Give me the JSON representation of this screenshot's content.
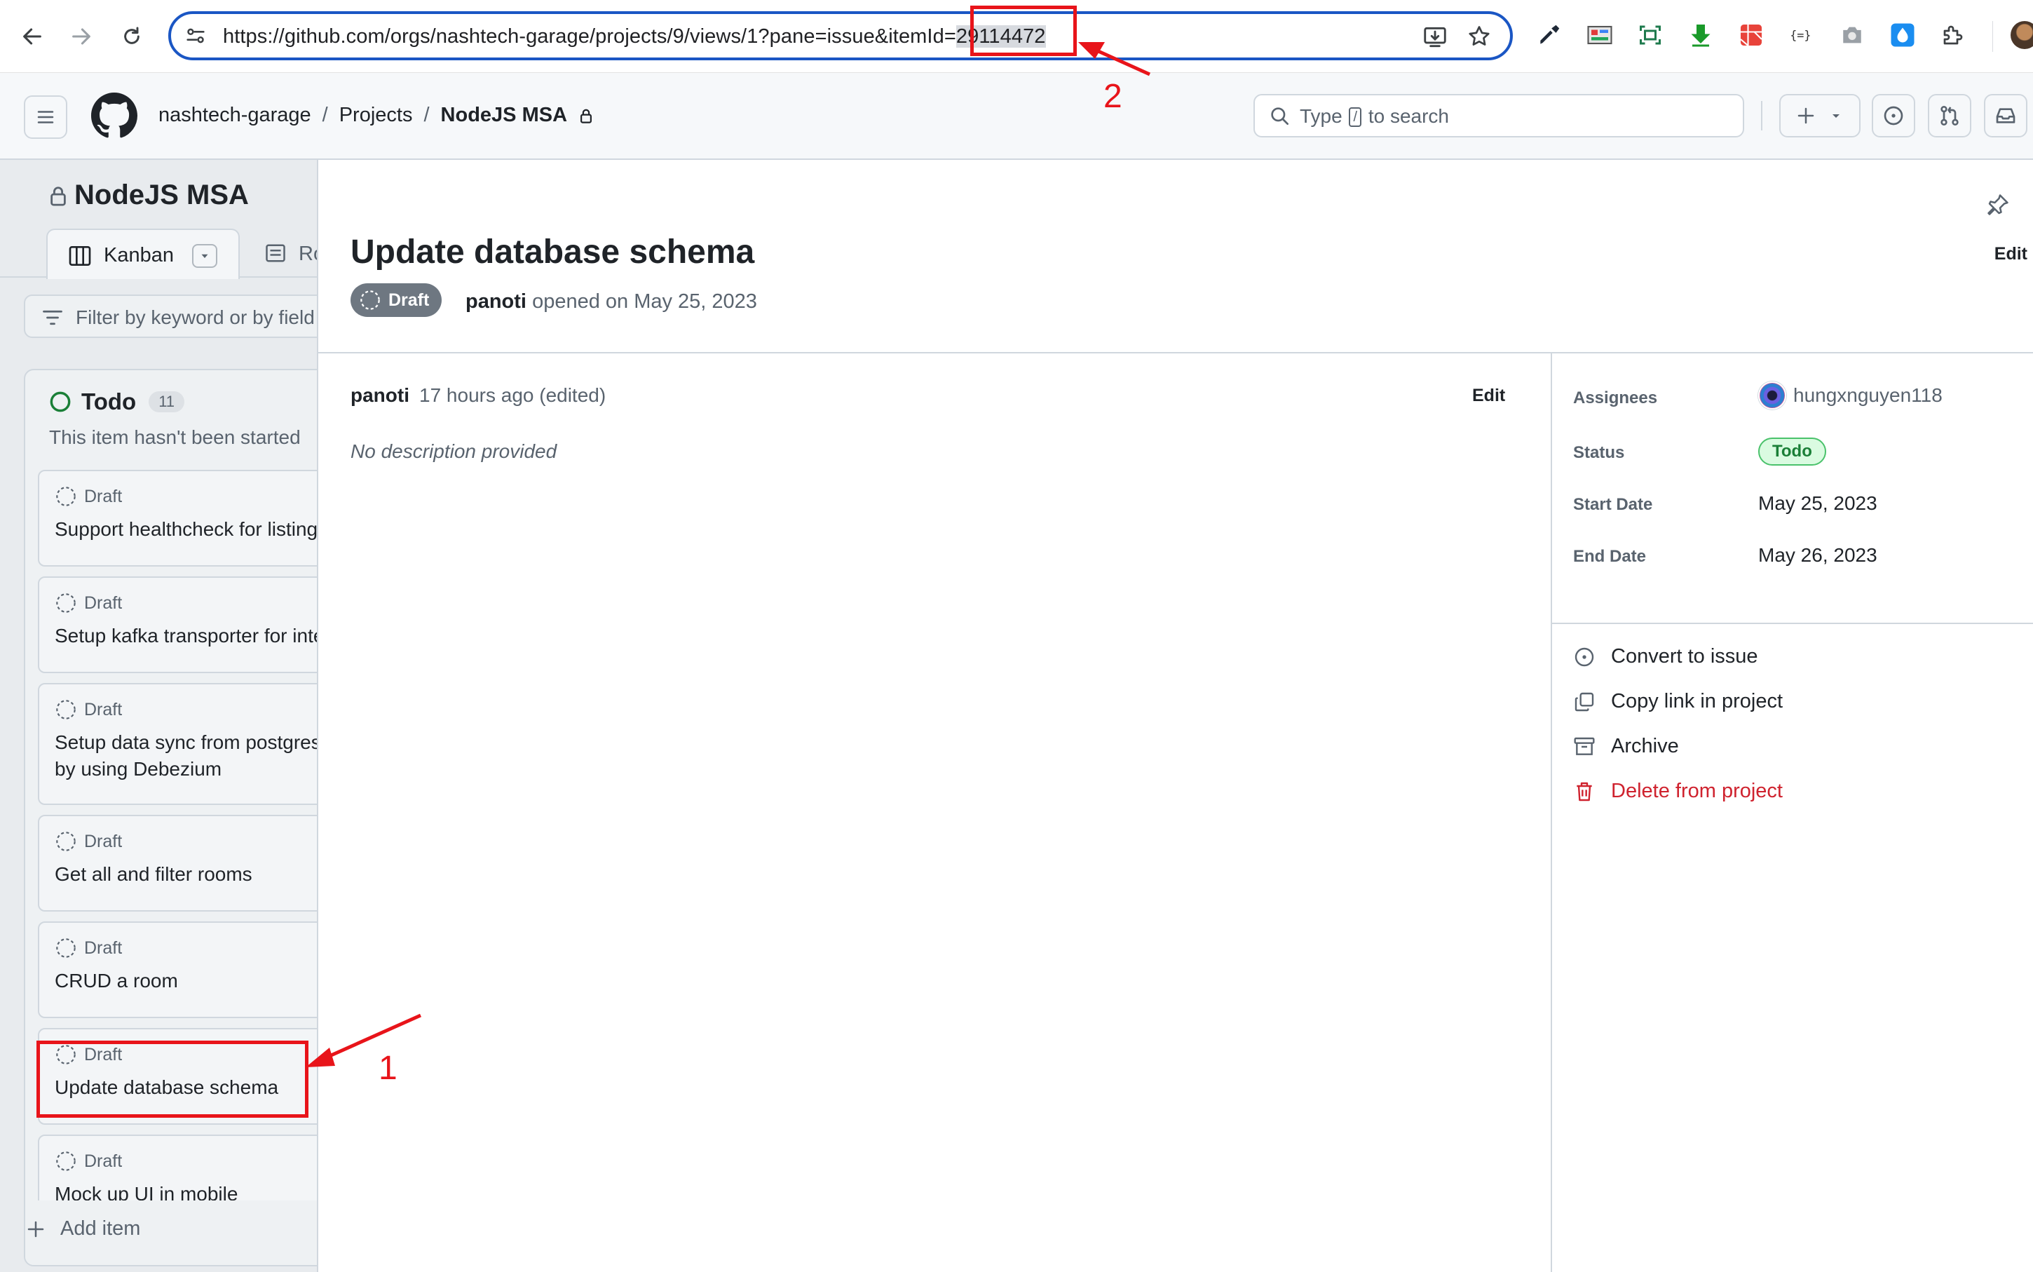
{
  "browser": {
    "url_prefix": "https://github.com/orgs/nashtech-garage/projects/9/views/1?pane=issue&itemId=",
    "url_item_id": "29114472"
  },
  "header": {
    "org": "nashtech-garage",
    "projects": "Projects",
    "project": "NodeJS MSA",
    "search_pre": "Type",
    "search_key": "/",
    "search_post": "to search"
  },
  "board": {
    "title": "NodeJS MSA",
    "tab_kanban": "Kanban",
    "tab_second": "Ro",
    "filter_placeholder": "Filter by keyword or by field",
    "column": {
      "name": "Todo",
      "count": "11",
      "description": "This item hasn't been started"
    },
    "cards": [
      {
        "status": "Draft",
        "title": "Support healthcheck for listing"
      },
      {
        "status": "Draft",
        "title": "Setup kafka transporter for inter"
      },
      {
        "status": "Draft",
        "title": "Setup data sync from postgres",
        "title2": "by using Debezium"
      },
      {
        "status": "Draft",
        "title": "Get all and filter rooms"
      },
      {
        "status": "Draft",
        "title": "CRUD a room"
      },
      {
        "status": "Draft",
        "title": "Update database schema"
      },
      {
        "status": "Draft",
        "title": "Mock up UI in mobile"
      }
    ],
    "add_item": "Add item"
  },
  "pane": {
    "edit_top": "Edit",
    "title": "Update database schema",
    "badge": "Draft",
    "author": "panoti",
    "opened_text": "opened on May 25, 2023",
    "comment_author": "panoti",
    "comment_meta": "17 hours ago (edited)",
    "comment_edit": "Edit",
    "description": "No description provided",
    "fields": {
      "assignees_label": "Assignees",
      "assignee": "hungxnguyen118",
      "status_label": "Status",
      "status": "Todo",
      "start_label": "Start Date",
      "start": "May 25, 2023",
      "end_label": "End Date",
      "end": "May 26, 2023"
    },
    "actions": {
      "convert": "Convert to issue",
      "copy": "Copy link in project",
      "archive": "Archive",
      "delete": "Delete from project"
    }
  },
  "annotations": {
    "label_1": "1",
    "label_2": "2"
  },
  "colors": {
    "accent_blue": "#1a56c4",
    "annotation_red": "#e8141a",
    "danger": "#cf222e",
    "todo_green": "#1a7f37"
  }
}
